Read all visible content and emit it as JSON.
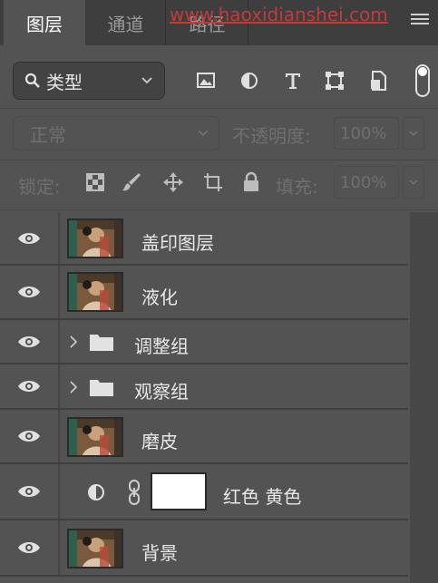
{
  "tabs": [
    {
      "label": "图层",
      "active": true
    },
    {
      "label": "通道",
      "active": false
    },
    {
      "label": "路径",
      "active": false
    }
  ],
  "watermark": "www.haoxidianshei.com",
  "filter": {
    "kind_label": "类型",
    "icons": [
      "image-filter-icon",
      "adjustment-filter-icon",
      "type-filter-icon",
      "shape-filter-icon",
      "smart-object-filter-icon",
      "filter-toggle-switch"
    ]
  },
  "blend": {
    "mode": "正常",
    "opacity_label": "不透明度:",
    "opacity_value": "100%"
  },
  "lock": {
    "label": "锁定:",
    "fill_label": "填充:",
    "fill_value": "100%"
  },
  "layers": [
    {
      "name": "盖印图层",
      "kind": "pixel"
    },
    {
      "name": "液化",
      "kind": "pixel"
    },
    {
      "name": "调整组",
      "kind": "group"
    },
    {
      "name": "观察组",
      "kind": "group"
    },
    {
      "name": "磨皮",
      "kind": "pixel"
    },
    {
      "name": "红色 黄色",
      "kind": "adjustment"
    },
    {
      "name": "背景",
      "kind": "pixel"
    }
  ],
  "colors": {
    "panel": "#535353",
    "tabbar": "#3e3e3e",
    "watermark": "#c43a3a"
  }
}
